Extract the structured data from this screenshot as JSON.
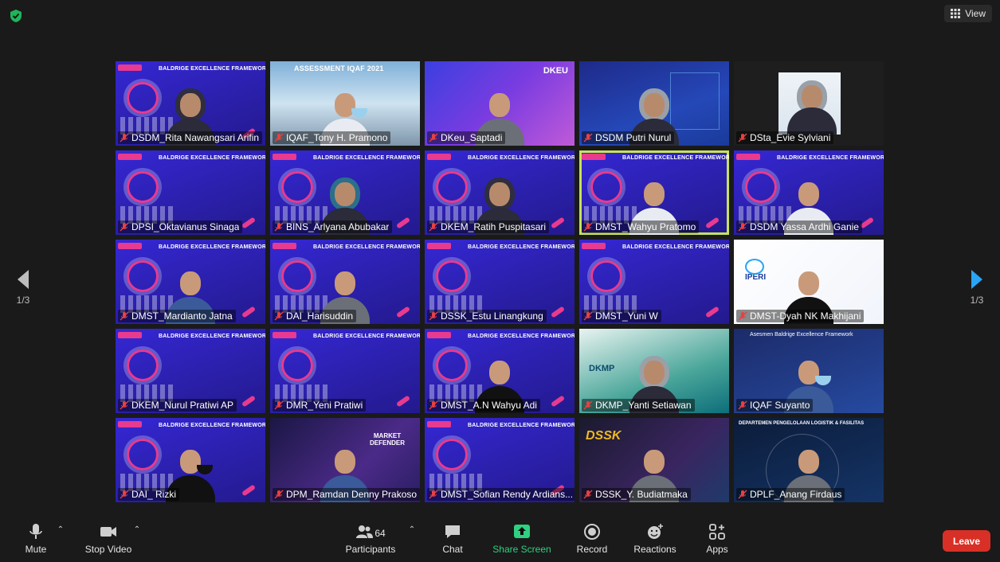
{
  "top": {
    "view_label": "View"
  },
  "nav": {
    "page_left": "1/3",
    "page_right": "1/3"
  },
  "participants": [
    {
      "name": "DSDM_Rita Nawangsari Arifin",
      "bg": "baldrige"
    },
    {
      "name": "IQAF_Tony H. Pramono",
      "bg": "iqaf"
    },
    {
      "name": "DKeu_Saptadi",
      "bg": "dkeu"
    },
    {
      "name": "DSDM Putri Nurul",
      "bg": "bi"
    },
    {
      "name": "DSta_Evie Sylviani",
      "bg": "plain"
    },
    {
      "name": "DPSI_Oktavianus Sinaga",
      "bg": "baldrige"
    },
    {
      "name": "BINS_Arlyana Abubakar",
      "bg": "baldrige"
    },
    {
      "name": "DKEM_Ratih Puspitasari",
      "bg": "baldrige"
    },
    {
      "name": "DMST_Wahyu Pratomo",
      "bg": "baldrige",
      "active": true
    },
    {
      "name": "DSDM Yassa Ardhi Ganie",
      "bg": "baldrige"
    },
    {
      "name": "DMST_Mardianto Jatna",
      "bg": "baldrige"
    },
    {
      "name": "DAI_Harisuddin",
      "bg": "baldrige"
    },
    {
      "name": "DSSK_Estu Linangkung",
      "bg": "baldrige"
    },
    {
      "name": "DMST_Yuni W",
      "bg": "baldrige"
    },
    {
      "name": "DMST-Dyah NK Makhijani",
      "bg": "iperi"
    },
    {
      "name": "DKEM_Nurul Pratiwi AP",
      "bg": "baldrige"
    },
    {
      "name": "DMR_Yeni Pratiwi",
      "bg": "baldrige"
    },
    {
      "name": "DMST_A.N Wahyu Adi",
      "bg": "baldrige"
    },
    {
      "name": "DKMP_Yanti Setiawan",
      "bg": "dkmp"
    },
    {
      "name": "IQAF Suyanto",
      "bg": "iqafsuy"
    },
    {
      "name": "DAI_ Rizki",
      "bg": "baldrige"
    },
    {
      "name": "DPM_Ramdan Denny Prakoso",
      "bg": "dpm"
    },
    {
      "name": "DMST_Sofian Rendy Ardians...",
      "bg": "baldrige"
    },
    {
      "name": "DSSK_Y. Budiatmaka",
      "bg": "dssk"
    },
    {
      "name": "DPLF_Anang Firdaus",
      "bg": "dplf"
    }
  ],
  "slides": {
    "baldrige_banner": "BALDRIGE EXCELLENCE FRAMEWORK",
    "iqaf_banner": "ASSESSMENT IQAF 2021",
    "dkeu_title": "DKEU",
    "dkmp_title": "DKMP",
    "dssk_title": "DSSK",
    "dplf_banner": "DEPARTEMEN PENGELOLAAN LOGISTIK & FASILITAS",
    "iperi_title": "IPERI",
    "iqafsuy_banner": "Asesmen Baldrige Excellence Framework",
    "dpm_title": "MARKET DEFENDER"
  },
  "toolbar": {
    "mute": "Mute",
    "stop_video": "Stop Video",
    "participants": "Participants",
    "participants_count": "64",
    "chat": "Chat",
    "share_screen": "Share Screen",
    "record": "Record",
    "reactions": "Reactions",
    "apps": "Apps",
    "leave": "Leave"
  },
  "colors": {
    "share": "#2fd07f",
    "leave": "#d83026",
    "active_speaker": "#c6e25a",
    "nav_arrow": "#2aa5f5"
  }
}
